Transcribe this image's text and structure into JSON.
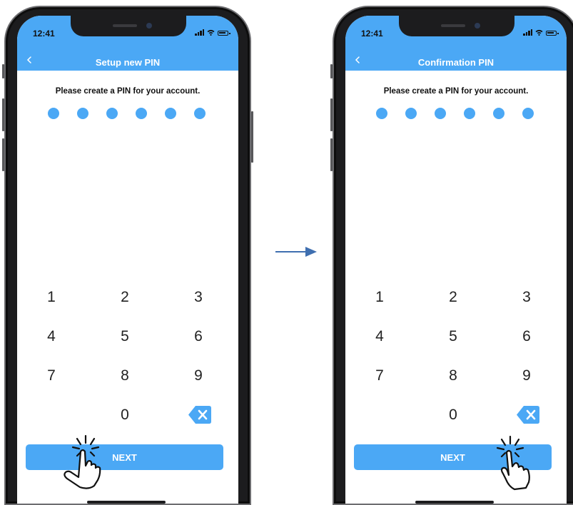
{
  "screens": [
    {
      "status": {
        "time": "12:41"
      },
      "header": {
        "title": "Setup new PIN",
        "back_icon": "chevron-left-icon"
      },
      "prompt": "Please create a PIN for your account.",
      "pin": {
        "length": 6,
        "filled": 6
      },
      "keypad": {
        "keys": [
          "1",
          "2",
          "3",
          "4",
          "5",
          "6",
          "7",
          "8",
          "9",
          "0"
        ]
      },
      "next_label": "NEXT"
    },
    {
      "status": {
        "time": "12:41"
      },
      "header": {
        "title": "Confirmation PIN",
        "back_icon": "chevron-left-icon"
      },
      "prompt": "Please create a PIN for your account.",
      "pin": {
        "length": 6,
        "filled": 6
      },
      "keypad": {
        "keys": [
          "1",
          "2",
          "3",
          "4",
          "5",
          "6",
          "7",
          "8",
          "9",
          "0"
        ]
      },
      "next_label": "NEXT"
    }
  ],
  "colors": {
    "accent": "#4ba8f5",
    "frame": "#1c1c1e",
    "arrow": "#3f6fb0"
  },
  "icons": {
    "transition": "arrow-right-icon",
    "tap_gesture": "tap-hand-icon",
    "delete": "backspace-icon"
  }
}
